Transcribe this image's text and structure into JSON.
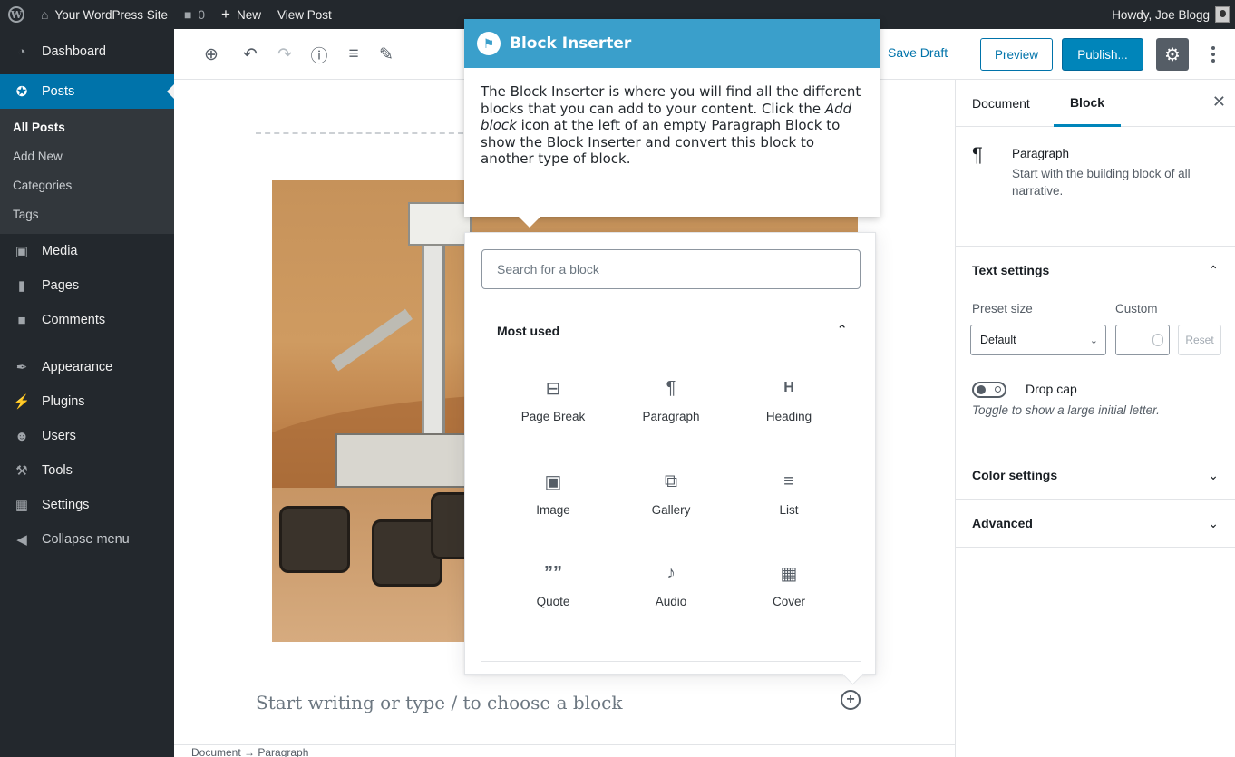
{
  "admin_bar": {
    "site_name": "Your WordPress Site",
    "comments_count": "0",
    "new_label": "New",
    "view_post_label": "View Post",
    "greeting": "Howdy, Joe Blogg"
  },
  "sidebar": {
    "items": [
      {
        "label": "Dashboard",
        "icon": "dashboard-icon"
      },
      {
        "label": "Posts",
        "icon": "pin-icon"
      },
      {
        "label": "Media",
        "icon": "media-icon"
      },
      {
        "label": "Pages",
        "icon": "pages-icon"
      },
      {
        "label": "Comments",
        "icon": "comments-icon"
      },
      {
        "label": "Appearance",
        "icon": "brush-icon"
      },
      {
        "label": "Plugins",
        "icon": "plugin-icon"
      },
      {
        "label": "Users",
        "icon": "users-icon"
      },
      {
        "label": "Tools",
        "icon": "wrench-icon"
      },
      {
        "label": "Settings",
        "icon": "settings-icon"
      },
      {
        "label": "Collapse menu",
        "icon": "collapse-icon"
      }
    ],
    "posts_submenu": [
      "All Posts",
      "Add New",
      "Categories",
      "Tags"
    ]
  },
  "editor_header": {
    "save_draft": "Save Draft",
    "preview": "Preview",
    "publish": "Publish..."
  },
  "content": {
    "placeholder": "Start writing or type / to choose a block"
  },
  "breadcrumb": {
    "text": "Document → Paragraph"
  },
  "settings_sidebar": {
    "tabs": [
      "Document",
      "Block"
    ],
    "active_tab": "Block",
    "block_name": "Paragraph",
    "block_description": "Start with the building block of all narrative.",
    "text_settings": {
      "title": "Text settings",
      "preset_label": "Preset size",
      "custom_label": "Custom",
      "preset_value": "Default",
      "reset_label": "Reset",
      "drop_cap_label": "Drop cap",
      "drop_cap_help": "Toggle to show a large initial letter."
    },
    "color_settings": "Color settings",
    "advanced": "Advanced"
  },
  "inserter": {
    "search_placeholder": "Search for a block",
    "section_title": "Most used",
    "blocks": [
      {
        "label": "Page Break",
        "icon": "page-break-icon"
      },
      {
        "label": "Paragraph",
        "icon": "paragraph-icon"
      },
      {
        "label": "Heading",
        "icon": "heading-icon"
      },
      {
        "label": "Image",
        "icon": "image-icon"
      },
      {
        "label": "Gallery",
        "icon": "gallery-icon"
      },
      {
        "label": "List",
        "icon": "list-icon"
      },
      {
        "label": "Quote",
        "icon": "quote-icon"
      },
      {
        "label": "Audio",
        "icon": "audio-icon"
      },
      {
        "label": "Cover",
        "icon": "cover-icon"
      }
    ]
  },
  "tour": {
    "title": "Block Inserter",
    "body_1": "The Block Inserter is where you will find all the different blocks that you can add to your content. Click the ",
    "body_em": "Add block",
    "body_2": " icon at the left of an empty Paragraph Block to show the Block Inserter and convert this block to another type of block."
  },
  "colors": {
    "admin_dark": "#23282d",
    "accent_blue": "#0073aa",
    "tour_blue": "#3a9fcb"
  }
}
